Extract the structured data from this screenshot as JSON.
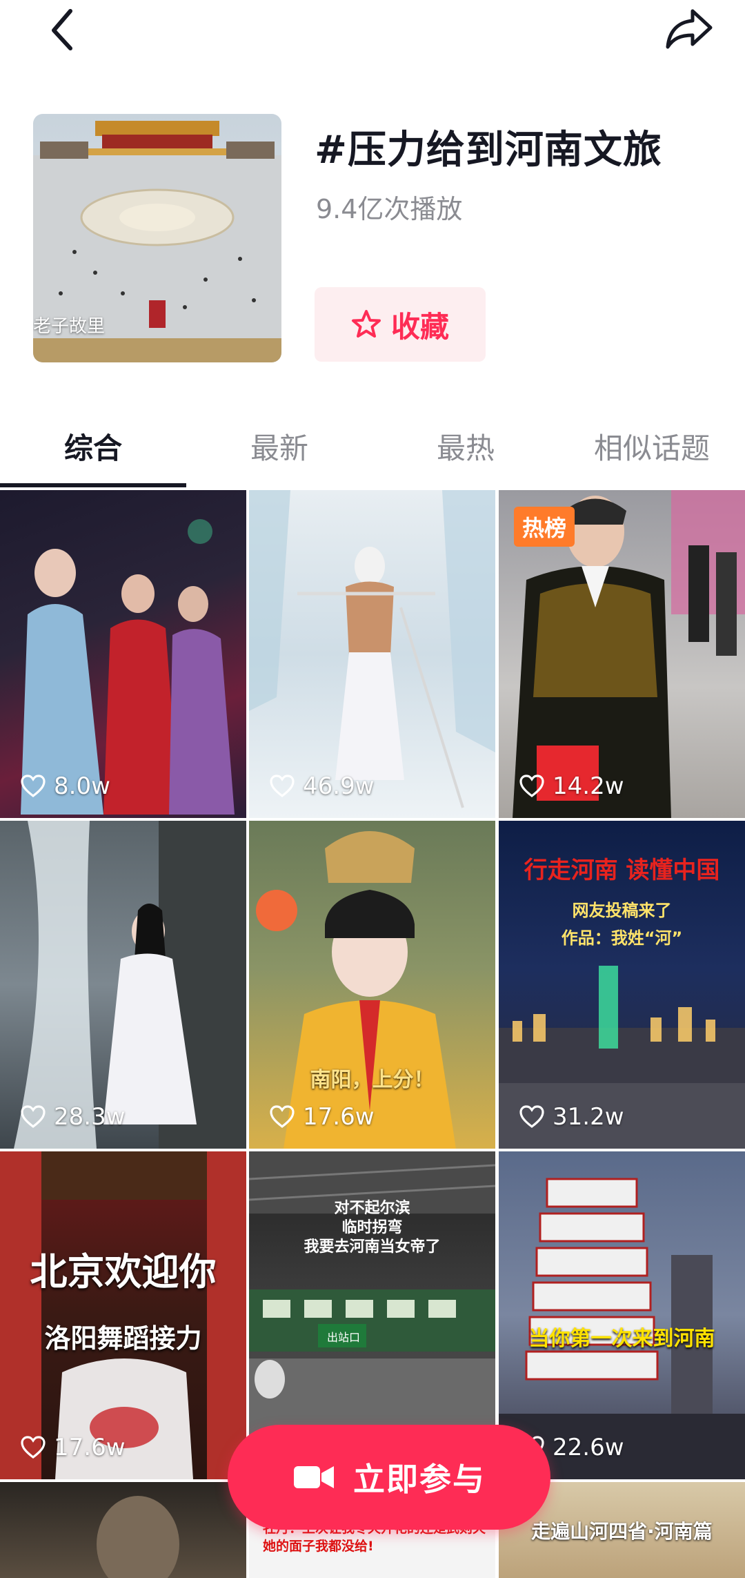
{
  "header": {
    "title": "#压力给到河南文旅",
    "play_count": "9.4亿次播放",
    "cover_caption": "老子故里",
    "favorite_label": "收藏"
  },
  "tabs": [
    {
      "label": "综合",
      "active": true
    },
    {
      "label": "最新",
      "active": false
    },
    {
      "label": "最热",
      "active": false
    },
    {
      "label": "相似话题",
      "active": false
    }
  ],
  "videos": [
    {
      "likes": "8.0w",
      "badge": ""
    },
    {
      "likes": "46.9w",
      "badge": ""
    },
    {
      "likes": "14.2w",
      "badge": "热榜"
    },
    {
      "likes": "28.3w",
      "badge": ""
    },
    {
      "likes": "17.6w",
      "badge": "",
      "overlay": "南阳，上分！"
    },
    {
      "likes": "31.2w",
      "badge": "",
      "overlay_lines": [
        "行走河南 读懂中国",
        "网友投稿来了",
        "作品：我姓“河”"
      ]
    },
    {
      "likes": "17.6w",
      "badge": "",
      "overlay_lines": [
        "北京欢迎你",
        "洛阳舞蹈接力"
      ]
    },
    {
      "likes": "",
      "badge": "",
      "overlay_lines": [
        "对不起尔滨",
        "临时拐弯",
        "我要去河南当女帝了"
      ],
      "sign": "出站口"
    },
    {
      "likes": "22.6w",
      "badge": "",
      "overlay": "当你第一次来到河南"
    },
    {
      "likes": "",
      "badge": ""
    },
    {
      "likes": "",
      "badge": "",
      "overlay_lines": [
        "牡丹：上次让我冬天开花的还是武则天",
        "她的面子我都没给!"
      ]
    },
    {
      "likes": "",
      "badge": "",
      "overlay": "走遍山河四省·河南篇"
    }
  ],
  "cta": {
    "label": "立即参与"
  },
  "colors": {
    "accent": "#fe2c55",
    "badge": "#ff7b2a",
    "text": "#161823",
    "muted": "#8a8b91"
  },
  "icons": [
    "back-arrow-icon",
    "share-icon",
    "star-icon",
    "heart-icon",
    "video-camera-icon"
  ]
}
